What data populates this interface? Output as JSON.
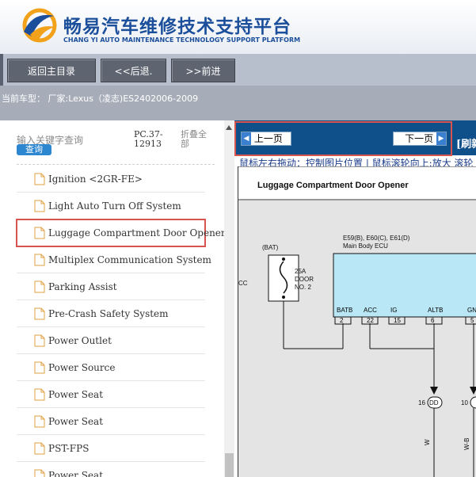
{
  "header": {
    "title_cn": "畅易汽车维修技术支持平台",
    "title_en": "CHANG YI AUTO MAINTENANCE TECHNOLOGY SUPPORT PLATFORM"
  },
  "toolbar": {
    "home_label": "返回主目录",
    "back_label": "<<后退.",
    "forward_label": ">>前进"
  },
  "model_row": {
    "text": "当前车型： 厂家:Lexus（凌志)ES2402006-2009"
  },
  "search": {
    "label": "输入关键字查询",
    "button_label": "查询",
    "pc_code": "PC.37-12913",
    "fold_label": "折叠全部"
  },
  "tree_items": [
    {
      "label": "Ignition <2GR-FE>"
    },
    {
      "label": "Light Auto Turn Off System"
    },
    {
      "label": "Luggage Compartment Door Opener",
      "selected": true
    },
    {
      "label": "Multiplex Communication System"
    },
    {
      "label": "Parking Assist"
    },
    {
      "label": "Pre-Crash Safety System"
    },
    {
      "label": "Power Outlet"
    },
    {
      "label": "Power Source"
    },
    {
      "label": "Power Seat"
    },
    {
      "label": "Power Seat"
    },
    {
      "label": "PST-FPS"
    },
    {
      "label": "Power Seat"
    }
  ],
  "viewer": {
    "prev_label": "上一页",
    "next_label": "下一页",
    "refresh_label": "[刷新",
    "hint": "鼠标左右拖动：控制图片位置 | 鼠标滚轮向上:放大  滚轮"
  },
  "diagram": {
    "title": "Luggage Compartment Door Opener",
    "ecu_code": "E59(B), E60(C), E61(D)",
    "ecu_name": "Main Body ECU",
    "bat_label": "(BAT)",
    "fuse_label": [
      "25A",
      "DOOR",
      "NO. 2"
    ],
    "cc_label": "CC",
    "pins": [
      {
        "name": "BATB",
        "num": "2"
      },
      {
        "name": "ACC",
        "num": "22"
      },
      {
        "name": "IG",
        "num": "15"
      },
      {
        "name": "ALTB",
        "num": "6"
      },
      {
        "name": "GN",
        "num": "5"
      }
    ],
    "connector_16": "16",
    "connector_dd": "DD",
    "connector_10": "10",
    "wire_w": "W",
    "wire_wb": "W-B"
  },
  "colors": {
    "brand_blue": "#1c4f9b",
    "nav_blue": "#0f4f8a",
    "toolbar_button": "#5e6470",
    "highlight_red": "#d9534f",
    "ecu_fill": "#b9e7f5"
  }
}
